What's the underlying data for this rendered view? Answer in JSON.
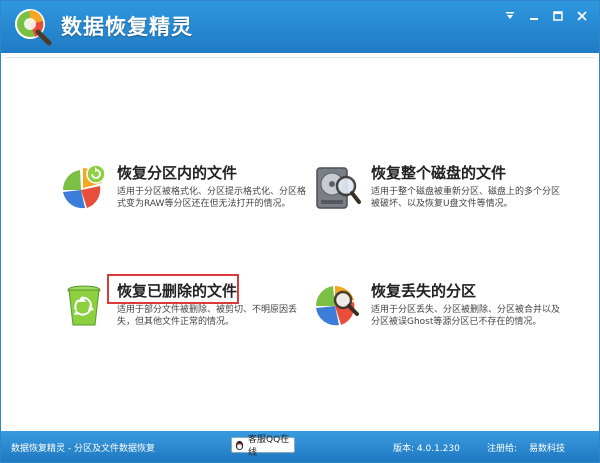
{
  "app": {
    "title": "数据恢复精灵"
  },
  "options": [
    {
      "title": "恢复分区内的文件",
      "description": "适用于分区被格式化、分区提示格式化、分区格式变为RAW等分区还在但无法打开的情况。",
      "icon": "pie-chart-refresh-icon"
    },
    {
      "title": "恢复整个磁盘的文件",
      "description": "适用于整个磁盘被重新分区、磁盘上的多个分区被破坏、以及恢复U盘文件等情况。",
      "icon": "hard-disk-magnifier-icon"
    },
    {
      "title": "恢复已删除的文件",
      "description": "适用于部分文件被删除、被剪切、不明原因丢失，但其他文件正常的情况。",
      "icon": "recycle-bin-icon"
    },
    {
      "title": "恢复丢失的分区",
      "description": "适用于分区丢失、分区被删除、分区被合并以及分区被误Ghost等源分区已不存在的情况。",
      "icon": "pie-chart-magnifier-icon"
    }
  ],
  "statusbar": {
    "app_desc": "数据恢复精灵 - 分区及文件数据恢复",
    "qq_label": "客服QQ在线",
    "version": "版本: 4.0.1.230",
    "registered_label": "注册给:",
    "registered_to": "易数科技"
  },
  "colors": {
    "titlebar": "#2f97df",
    "statusbar": "#1f78c0",
    "highlight": "#d93b3b"
  }
}
